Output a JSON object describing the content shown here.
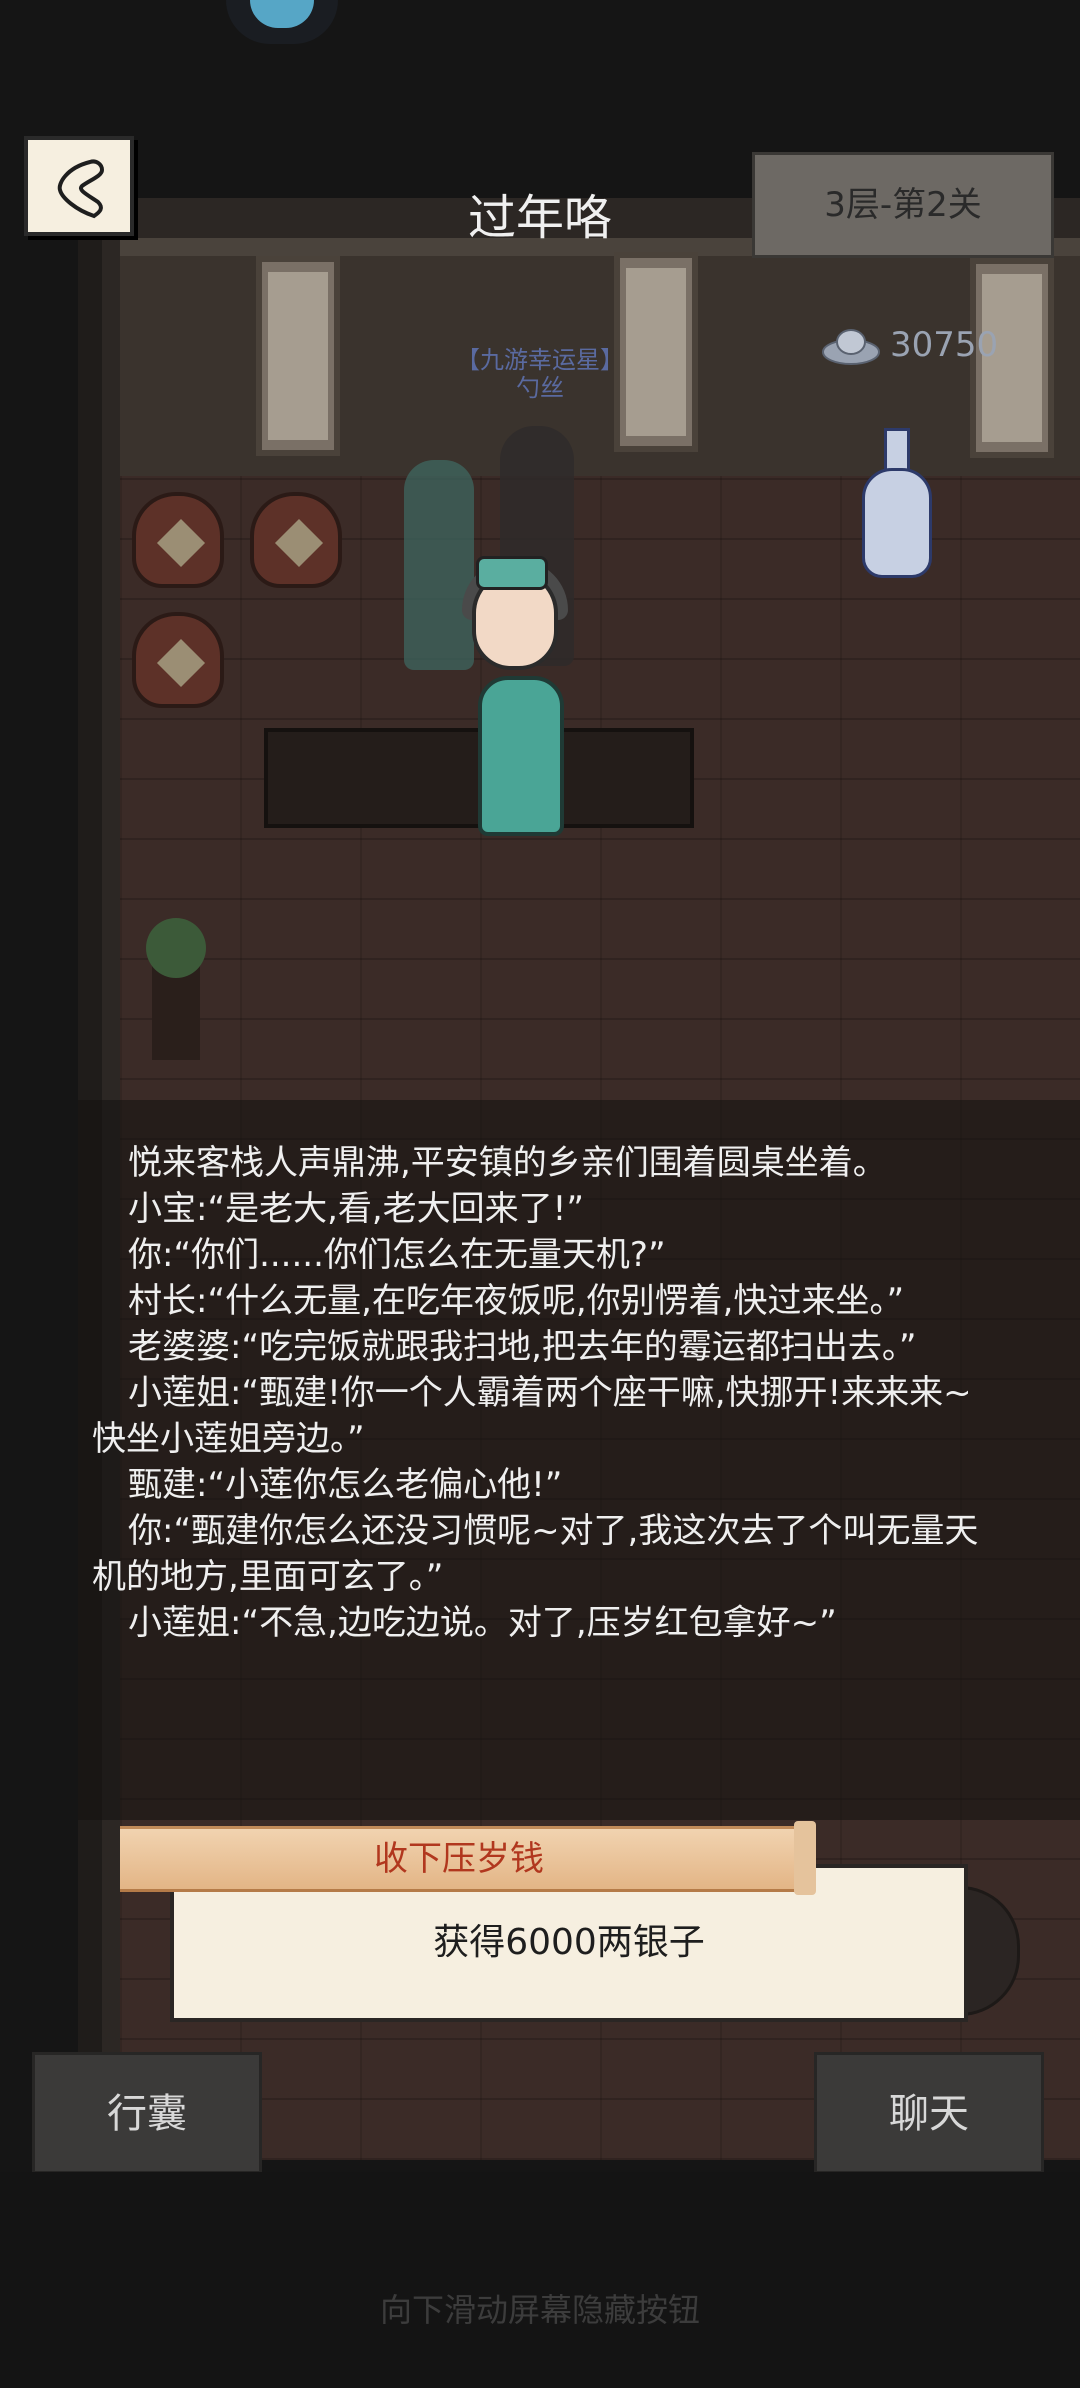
{
  "header": {
    "title": "过年咯",
    "level": "3层-第2关",
    "silver_amount": "30750",
    "back_icon": "back-arrow-icon"
  },
  "scene": {
    "npc_title": "【九游幸运星】",
    "npc_name": "勺丝"
  },
  "dialog": {
    "lines": [
      "悦来客栈人声鼎沸,平安镇的乡亲们围着圆桌坐着。",
      "小宝:“是老大,看,老大回来了!”",
      "你:“你们......你们怎么在无量天机?”",
      "村长:“什么无量,在吃年夜饭呢,你别愣着,快过来坐。”",
      "老婆婆:“吃完饭就跟我扫地,把去年的霉运都扫出去。”",
      "小莲姐:“甄建!你一个人霸着两个座干嘛,快挪开!来来来~快坐小莲姐旁边。”",
      "甄建:“小莲你怎么老偏心他!”",
      "你:“甄建你怎么还没习惯呢~对了,我这次去了个叫无量天机的地方,里面可玄了。”",
      "小莲姐:“不急,边吃边说。对了,压岁红包拿好~”"
    ]
  },
  "reward": {
    "tab_label": "收下压岁钱",
    "message": "获得6000两银子"
  },
  "footer": {
    "bag_label": "行囊",
    "chat_label": "聊天",
    "hint": "向下滑动屏幕隐藏按钮"
  },
  "colors": {
    "reward_title": "#b1371e",
    "panel_paper": "#f6efe0",
    "silver_text": "#9aa3b2"
  }
}
